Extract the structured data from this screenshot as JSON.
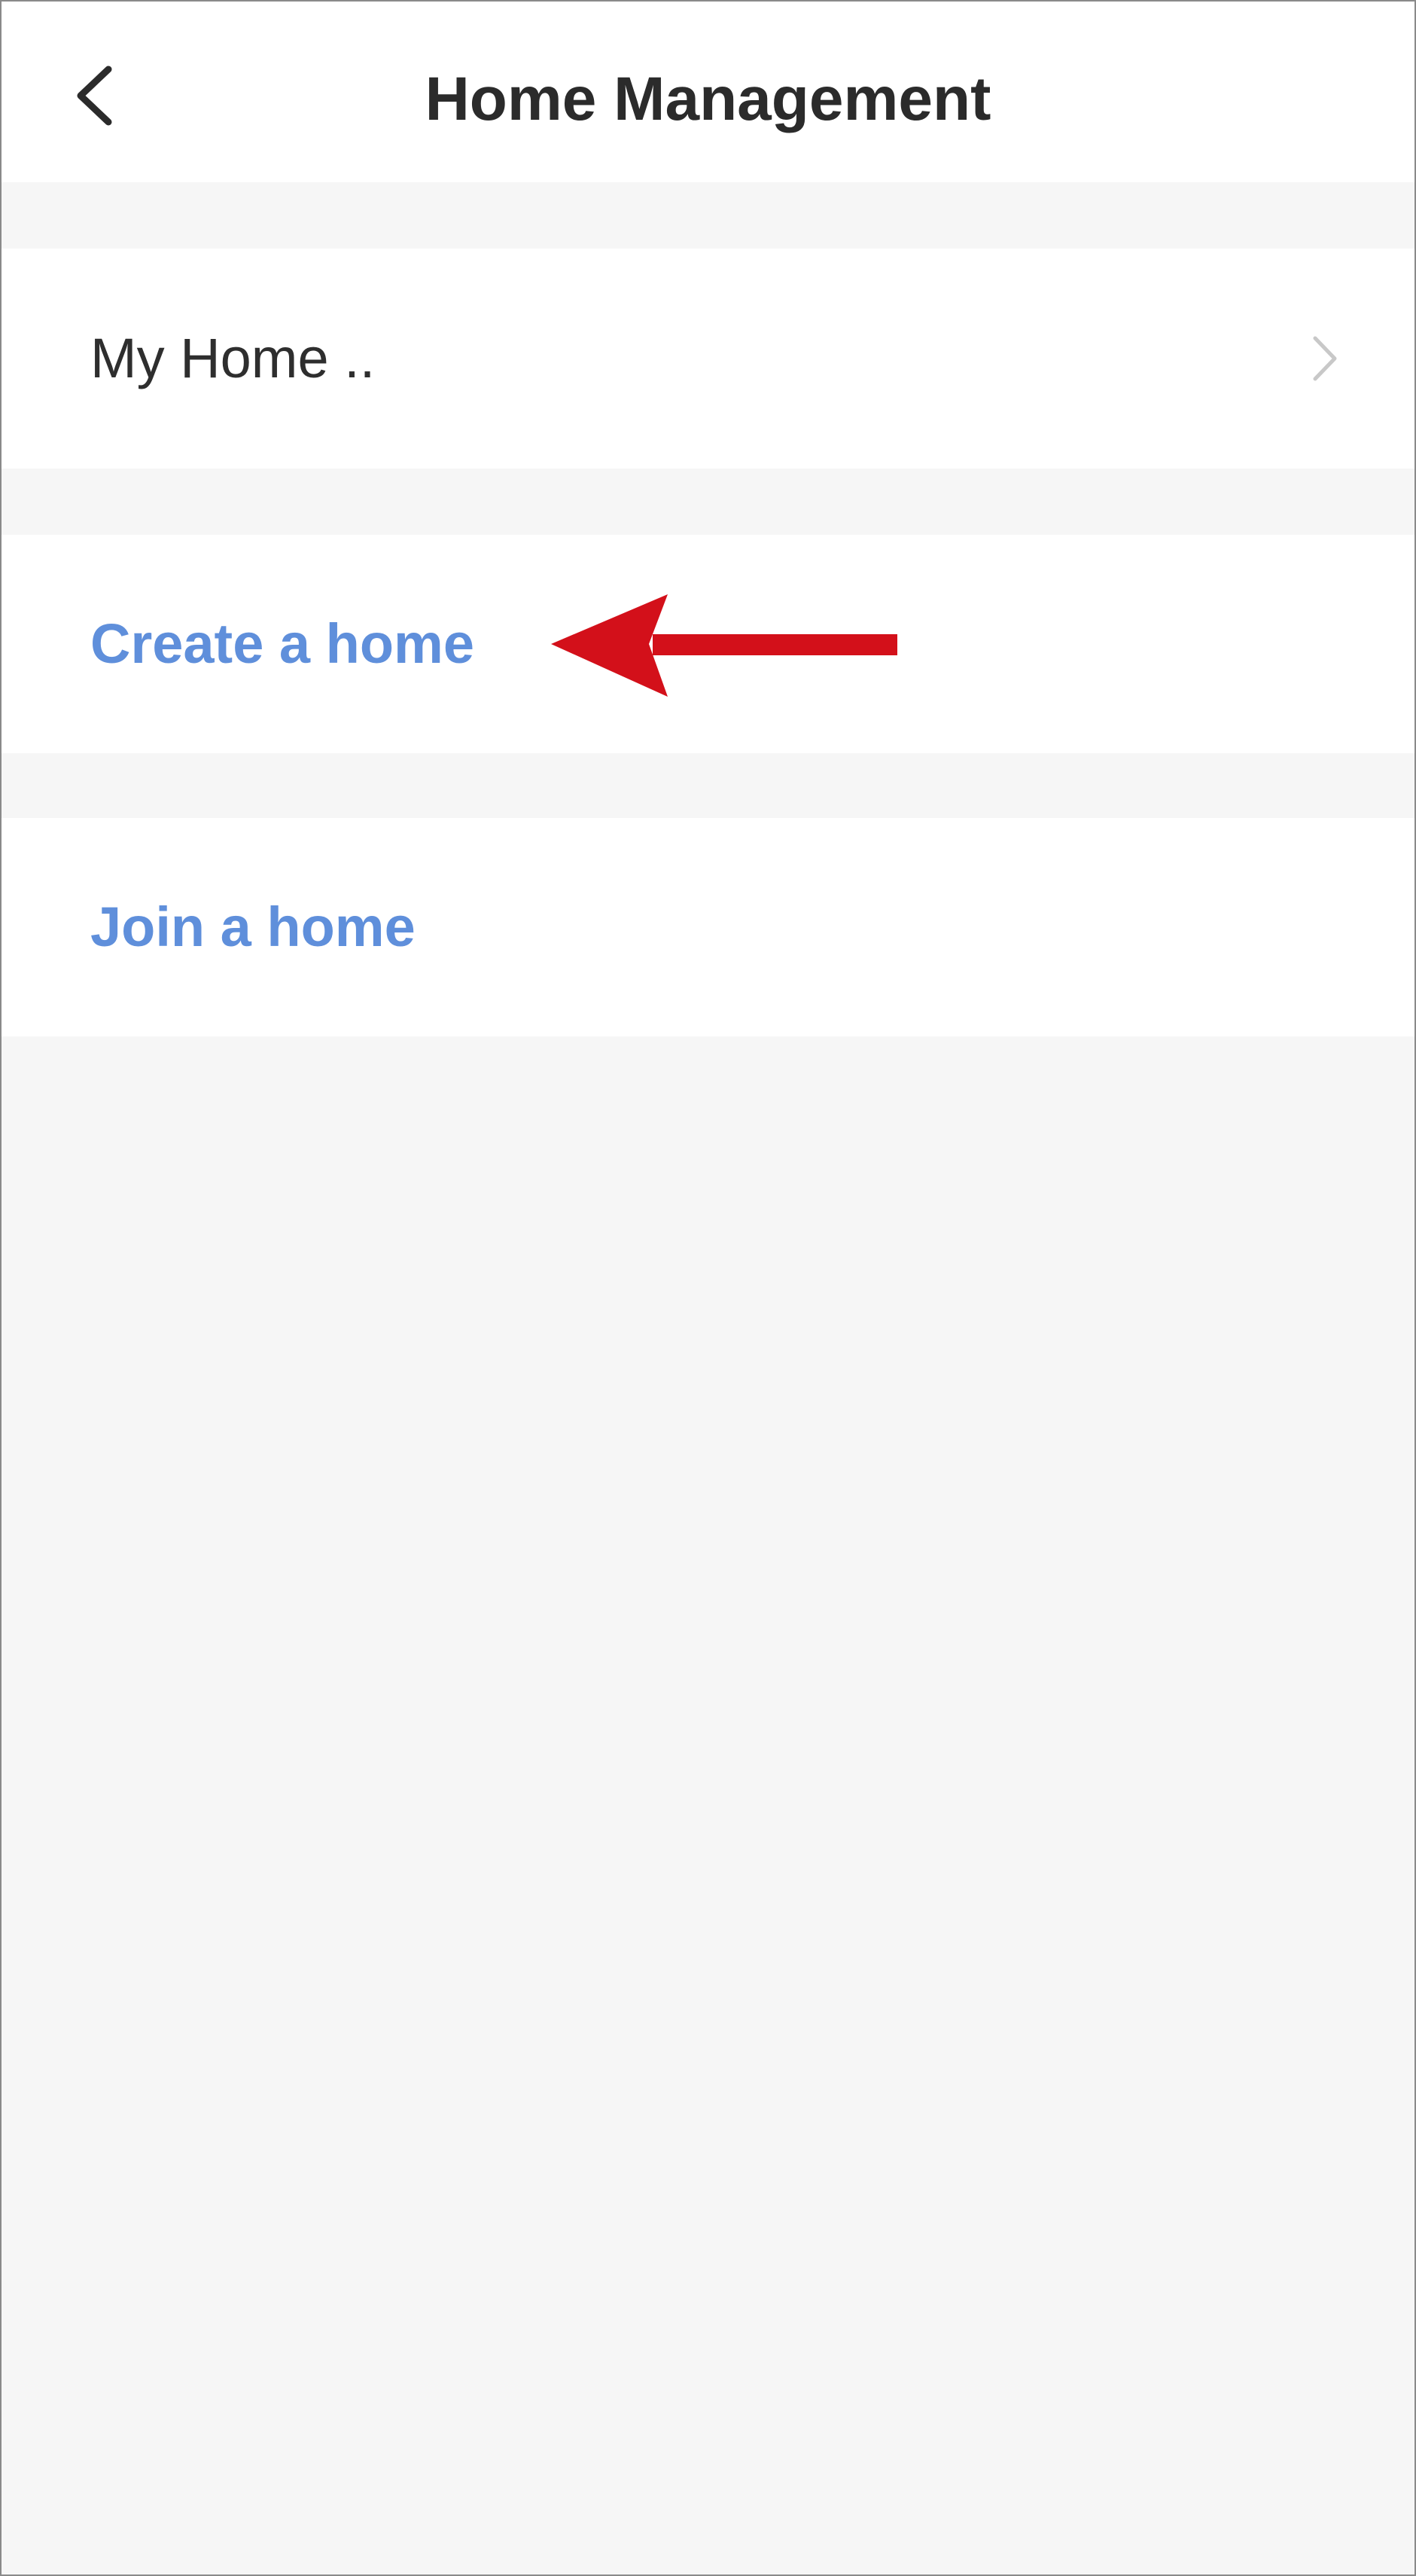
{
  "header": {
    "title": "Home Management",
    "back_icon": "chevron-left-icon"
  },
  "list": {
    "items": [
      {
        "label": "My Home ..",
        "style": "plain",
        "icon": "chevron-right-icon"
      },
      {
        "label": "Create a home",
        "style": "action"
      },
      {
        "label": "Join a home",
        "style": "action"
      }
    ]
  },
  "annotation": {
    "icon": "red-arrow-left-icon",
    "color": "#d3101a"
  },
  "colors": {
    "action_text": "#5f8fdb",
    "primary_text": "#2e2e2e",
    "background": "#f6f6f6",
    "surface": "#ffffff"
  }
}
